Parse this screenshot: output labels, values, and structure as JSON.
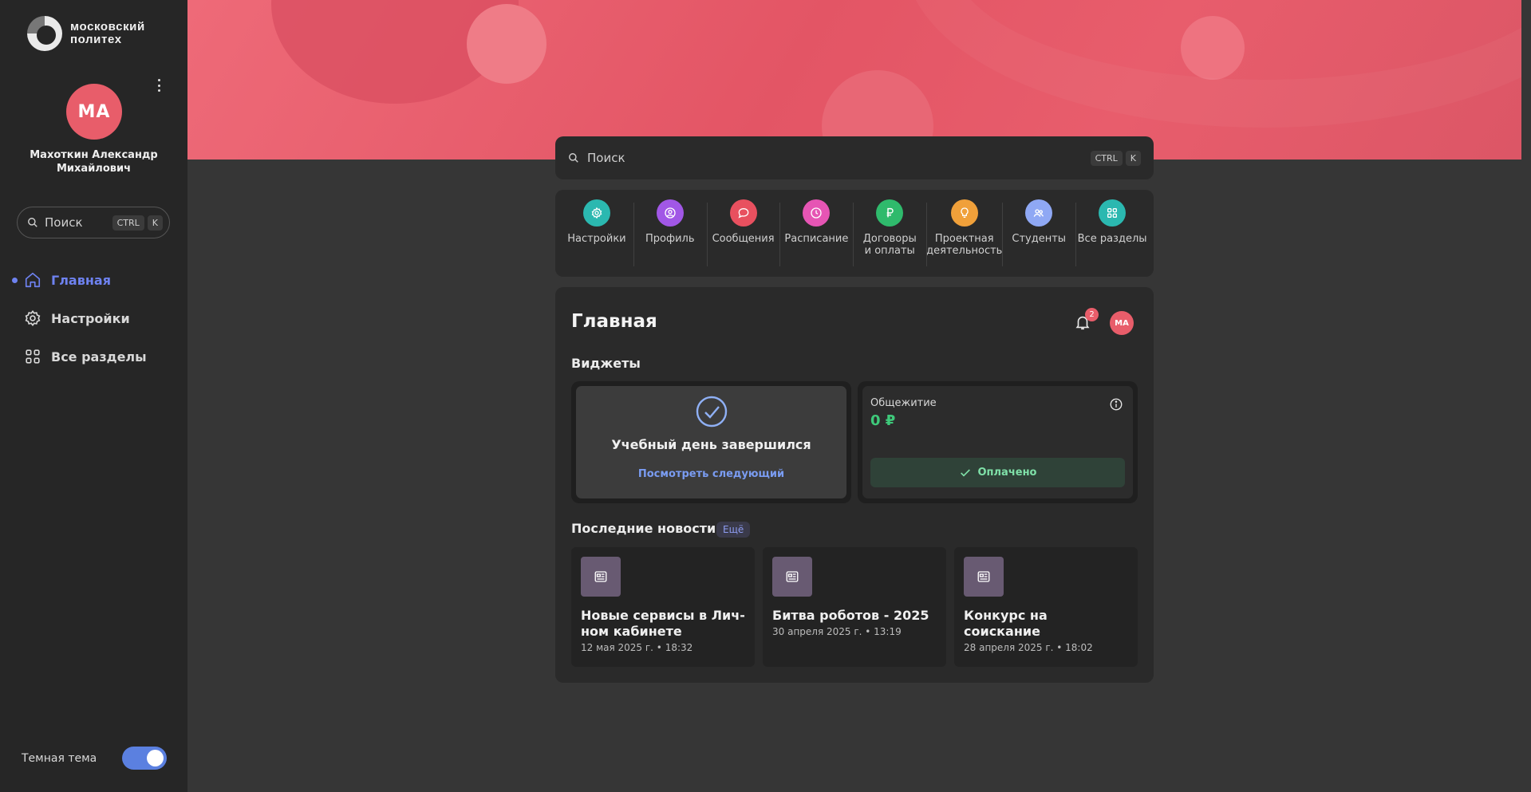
{
  "brand": {
    "logo_text": "московский политех"
  },
  "user": {
    "initials": "МА",
    "full_name": "Махоткин Александр Михайлович"
  },
  "sidebar": {
    "search": {
      "placeholder": "Поиск",
      "key1": "CTRL",
      "key2": "K"
    },
    "items": [
      {
        "label": "Главная",
        "icon": "home-icon",
        "active": true
      },
      {
        "label": "Настройки",
        "icon": "gear-icon",
        "active": false
      },
      {
        "label": "Все разделы",
        "icon": "grid-icon",
        "active": false
      }
    ],
    "theme": {
      "label": "Темная тема",
      "enabled": true
    }
  },
  "top_search": {
    "placeholder": "Поиск",
    "key1": "CTRL",
    "key2": "K"
  },
  "quick_links": [
    {
      "label": "Настройки",
      "icon": "gear-icon",
      "color": "#2bb8b0"
    },
    {
      "label": "Профиль",
      "icon": "profile-icon",
      "color": "#a157e6"
    },
    {
      "label": "Сообщения",
      "icon": "message-icon",
      "color": "#e8505f"
    },
    {
      "label": "Расписание",
      "icon": "clock-icon",
      "color": "#e655b4"
    },
    {
      "label": "Договоры\nи оплаты",
      "icon": "ruble-icon",
      "color": "#2fba6c"
    },
    {
      "label": "Проектная\nдеятельность",
      "icon": "lightbulb-icon",
      "color": "#f0a03a"
    },
    {
      "label": "Студенты",
      "icon": "students-icon",
      "color": "#8fa8f4"
    },
    {
      "label": "Все разделы",
      "icon": "grid-icon",
      "color": "#2bb8b0"
    }
  ],
  "main": {
    "title": "Главная",
    "notifications_count": "2",
    "avatar_initials": "МА",
    "widgets_title": "Виджеты",
    "schedule_widget": {
      "title": "Учебный день завершился",
      "link": "Посмотреть следующий"
    },
    "dorm_widget": {
      "title": "Общежитие",
      "amount": "0 ₽",
      "status": "Оплачено"
    },
    "news_title": "Последние новости",
    "news_more": "Ещё",
    "news": [
      {
        "title": "Новые сервисы в Лич­ном кабинете",
        "date": "12 мая 2025 г. • 18:32"
      },
      {
        "title": "Битва роботов - 2025",
        "date": "30 апреля 2025 г. • 13:19"
      },
      {
        "title": "Конкурс на соискание Национальной прем...",
        "date": "28 апреля 2025 г. • 18:02"
      }
    ]
  },
  "colors": {
    "accent": "#6e82f0",
    "brand_red": "#e85d6a",
    "success": "#3ec97a"
  }
}
